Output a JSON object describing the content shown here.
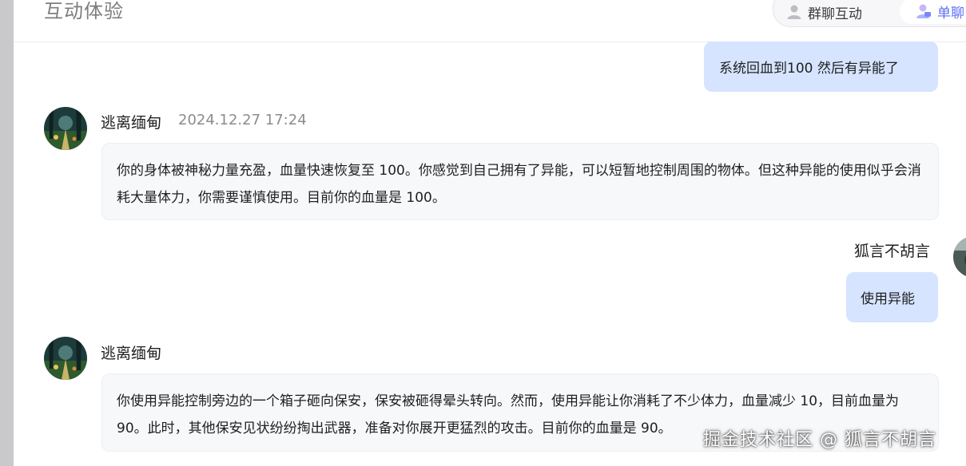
{
  "header": {
    "title": "互动体验",
    "modes": {
      "group_label": "群聊互动",
      "group_icon": "user-icon",
      "single_label": "单聊",
      "single_icon": "user-chat-icon"
    }
  },
  "messages": [
    {
      "role": "user",
      "text": "系统回血到100 然后有异能了"
    },
    {
      "role": "assistant",
      "name": "逃离缅甸",
      "time": "2024.12.27 17:24",
      "text": "你的身体被神秘力量充盈，血量快速恢复至 100。你感觉到自己拥有了异能，可以短暂地控制周围的物体。但这种异能的使用似乎会消耗大量体力，你需要谨慎使用。目前你的血量是 100。"
    },
    {
      "role": "user",
      "name": "狐言不胡言",
      "text": "使用异能"
    },
    {
      "role": "assistant",
      "name": "逃离缅甸",
      "text": "你使用异能控制旁边的一个箱子砸向保安，保安被砸得晕头转向。然而，使用异能让你消耗了不少体力，血量减少 10，目前血量为 90。此时，其他保安见状纷纷掏出武器，准备对你展开更猛烈的攻击。目前你的血量是 90。"
    }
  ],
  "watermark": "掘金技术社区 @ 狐言不胡言",
  "colors": {
    "user_bubble": "#d6e4ff",
    "ai_bubble": "#f7f8fa",
    "accent": "#5d6ef5"
  }
}
